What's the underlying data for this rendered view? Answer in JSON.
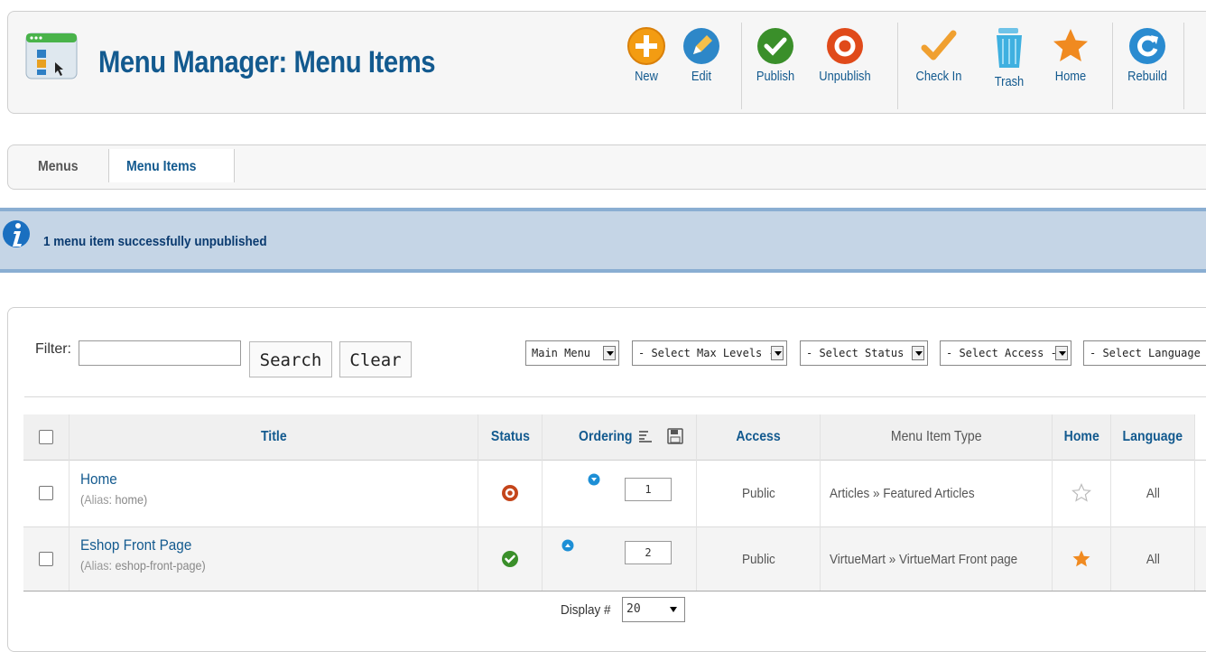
{
  "header": {
    "title": "Menu Manager: Menu Items"
  },
  "toolbar": {
    "buttons": [
      {
        "label": "New",
        "icon": "plus-circle-icon",
        "color": "#f39c12"
      },
      {
        "label": "Edit",
        "icon": "pencil-circle-icon",
        "color": "#2d87c8"
      },
      {
        "label": "Publish",
        "icon": "checkmark-circle-icon",
        "color": "#3a8f2a"
      },
      {
        "label": "Unpublish",
        "icon": "stop-circle-icon",
        "color": "#e04a1a"
      },
      {
        "label": "Check In",
        "icon": "checkmark-icon",
        "color": "#f0a030"
      },
      {
        "label": "Trash",
        "icon": "trash-icon",
        "color": "#3fb0e0"
      },
      {
        "label": "Home",
        "icon": "star-icon",
        "color": "#f08a20"
      },
      {
        "label": "Rebuild",
        "icon": "refresh-icon",
        "color": "#2a8bd0"
      }
    ]
  },
  "submenu": {
    "items": [
      {
        "label": "Menus",
        "active": false
      },
      {
        "label": "Menu Items",
        "active": true
      }
    ]
  },
  "message": {
    "text": "1 menu item successfully unpublished",
    "icon": "info-icon"
  },
  "filter": {
    "label": "Filter:",
    "value": "",
    "search_label": "Search",
    "clear_label": "Clear",
    "selects": [
      {
        "value": "Main Menu"
      },
      {
        "value": "- Select Max Levels -"
      },
      {
        "value": "- Select Status -"
      },
      {
        "value": "- Select Access -"
      },
      {
        "value": "- Select Language -"
      }
    ]
  },
  "table": {
    "columns": [
      "Title",
      "Status",
      "Ordering",
      "Access",
      "Menu Item Type",
      "Home",
      "Language"
    ],
    "rows": [
      {
        "title": "Home",
        "alias_key": "Alias",
        "alias": "home",
        "status": "unpublished",
        "order_arrow": "down",
        "ordering": "1",
        "access": "Public",
        "type": "Articles » Featured Articles",
        "home": false,
        "language": "All"
      },
      {
        "title": "Eshop Front Page",
        "alias_key": "Alias",
        "alias": "eshop-front-page",
        "status": "published",
        "order_arrow": "up",
        "ordering": "2",
        "access": "Public",
        "type": "VirtueMart » VirtueMart Front page",
        "home": true,
        "language": "All"
      }
    ]
  },
  "pagination": {
    "display_label": "Display #",
    "display_value": "20"
  },
  "colors": {
    "accent": "#135a8f",
    "message_bg": "#c5d5e6",
    "message_border": "#8aaed2"
  }
}
